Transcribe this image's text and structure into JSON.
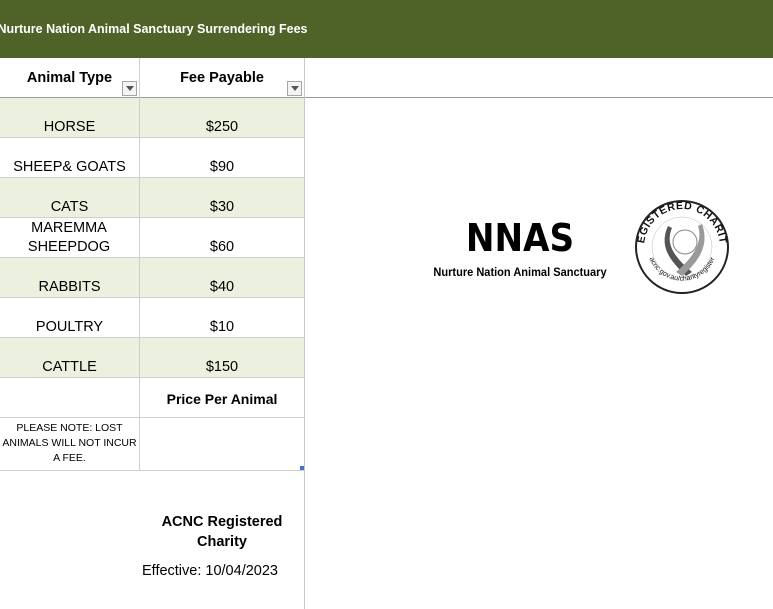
{
  "sheet": {
    "title": "Nurture Nation Animal Sanctuary Surrendering Fees",
    "columns": [
      "Animal Type",
      "Fee Payable"
    ],
    "rows": [
      {
        "animal": "HORSE",
        "fee": "$250"
      },
      {
        "animal": "SHEEP& GOATS",
        "fee": "$90"
      },
      {
        "animal": "CATS",
        "fee": "$30"
      },
      {
        "animal": "MAREMMA SHEEPDOG",
        "fee": "$60"
      },
      {
        "animal": "RABBITS",
        "fee": "$40"
      },
      {
        "animal": "POULTRY",
        "fee": "$10"
      },
      {
        "animal": "CATTLE",
        "fee": "$150"
      }
    ],
    "price_note": "Price Per Animal",
    "lost_note": "PLEASE NOTE: LOST ANIMALS WILL NOT INCUR A FEE.",
    "acnc_label": "ACNC Registered Charity",
    "effective": "Effective: 10/04/2023"
  },
  "logo": {
    "title": "NNAS",
    "subtitle": "Nurture Nation Animal Sanctuary",
    "seal_top": "REGISTERED CHARITY",
    "seal_bottom": "acnc.gov.au/charityregister"
  },
  "colors": {
    "banner": "#4f6228",
    "row_shade": "#ebf1de"
  }
}
